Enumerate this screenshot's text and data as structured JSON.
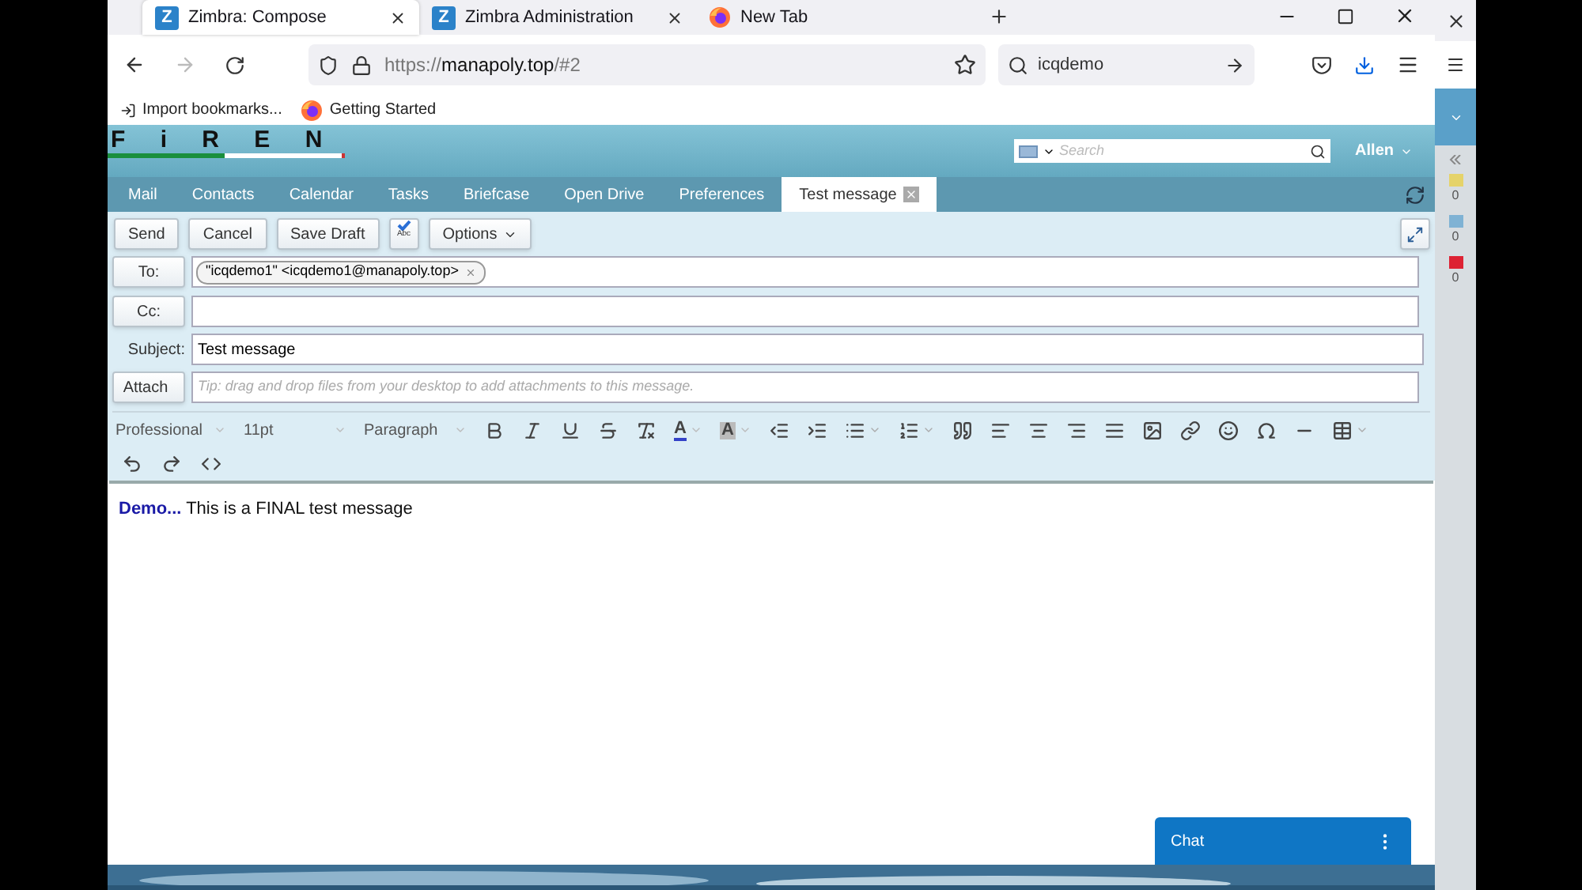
{
  "browser_tabs": [
    {
      "kind": "app",
      "icon_letter": "Z",
      "title": "Zimbra: Compose",
      "selected": true
    },
    {
      "kind": "app",
      "icon_letter": "Z",
      "title": "Zimbra Administration",
      "selected": false
    },
    {
      "kind": "firefox",
      "title": "New Tab",
      "selected": false
    }
  ],
  "address": {
    "scheme": "https://",
    "host": "manapoly.top",
    "path": "/#2"
  },
  "web_search": {
    "value": "icqdemo"
  },
  "bookmarks": [
    {
      "kind": "import",
      "label": "Import bookmarks..."
    },
    {
      "kind": "firefox",
      "label": "Getting Started"
    }
  ],
  "app_header": {
    "logo": "F i R E N",
    "search_placeholder": "Search",
    "user": "Allen"
  },
  "app_tabs": [
    {
      "label": "Mail",
      "selected": false
    },
    {
      "label": "Contacts",
      "selected": false
    },
    {
      "label": "Calendar",
      "selected": false
    },
    {
      "label": "Tasks",
      "selected": false
    },
    {
      "label": "Briefcase",
      "selected": false
    },
    {
      "label": "Open Drive",
      "selected": false
    },
    {
      "label": "Preferences",
      "selected": false
    },
    {
      "label": "Test message",
      "selected": true
    }
  ],
  "compose_toolbar": {
    "send": "Send",
    "cancel": "Cancel",
    "save_draft": "Save Draft",
    "spell_label": "Abc",
    "options": "Options"
  },
  "fields": {
    "to_label": "To:",
    "to_recipients": [
      "\"icqdemo1\" <icqdemo1@manapoly.top>"
    ],
    "cc_label": "Cc:",
    "subject_label": "Subject:",
    "subject": "Test message",
    "attach_label": "Attach",
    "attach_placeholder": "Tip: drag and drop files from your desktop to add attachments to this message."
  },
  "editor": {
    "font": "Professional",
    "size": "11pt",
    "format": "Paragraph",
    "text_color_label": "A",
    "highlight_label": "A",
    "body": "**Demo...** This is a FINAL test message"
  },
  "chat": {
    "label": "Chat"
  },
  "side_counts": [
    "0",
    "0",
    "0"
  ]
}
